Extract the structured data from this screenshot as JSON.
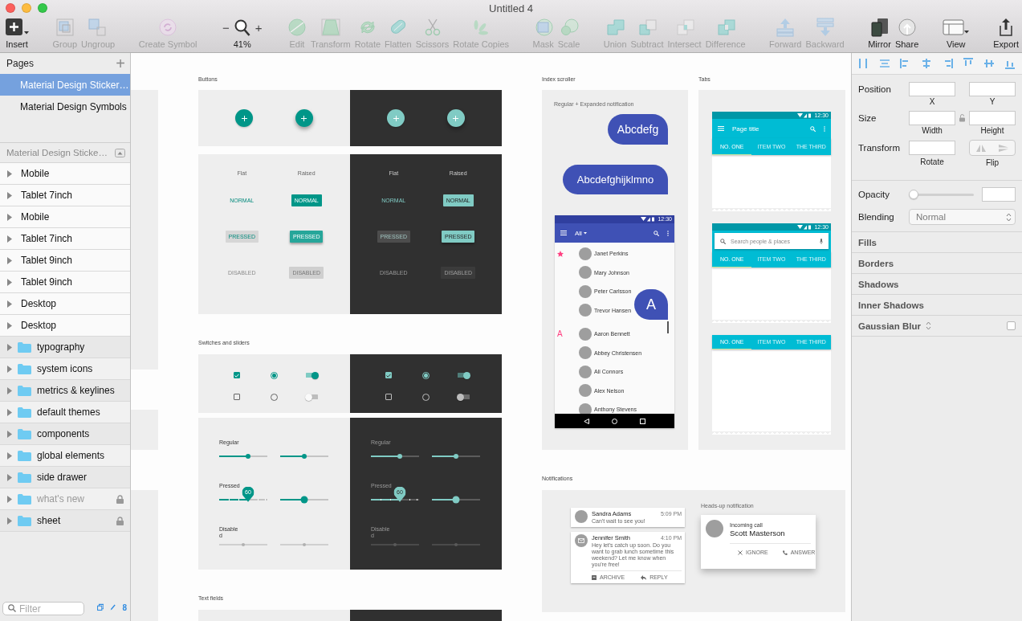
{
  "window": {
    "title": "Untitled 4"
  },
  "toolbar": {
    "groups": [
      {
        "items": [
          {
            "kind": "insert",
            "label": "Insert",
            "disabled": false
          }
        ]
      },
      {
        "items": [
          {
            "kind": "group",
            "label": "Group",
            "disabled": true
          },
          {
            "kind": "ungroup",
            "label": "Ungroup",
            "disabled": true
          }
        ]
      },
      {
        "items": [
          {
            "kind": "symbol",
            "label": "Create Symbol",
            "disabled": true
          }
        ]
      },
      {
        "items": [
          {
            "kind": "zoom",
            "label": "41%",
            "minus": "−",
            "plus": "+"
          }
        ]
      },
      {
        "items": [
          {
            "kind": "edit",
            "label": "Edit",
            "disabled": true
          },
          {
            "kind": "transform",
            "label": "Transform",
            "disabled": true
          },
          {
            "kind": "rotate",
            "label": "Rotate",
            "disabled": true
          },
          {
            "kind": "flatten",
            "label": "Flatten",
            "disabled": true
          },
          {
            "kind": "scissors",
            "label": "Scissors",
            "disabled": true
          },
          {
            "kind": "rotate_copies",
            "label": "Rotate Copies",
            "disabled": true
          }
        ]
      },
      {
        "items": [
          {
            "kind": "mask",
            "label": "Mask",
            "disabled": true
          },
          {
            "kind": "scale",
            "label": "Scale",
            "disabled": true
          }
        ]
      },
      {
        "items": [
          {
            "kind": "union",
            "label": "Union",
            "disabled": true
          },
          {
            "kind": "subtract",
            "label": "Subtract",
            "disabled": true
          },
          {
            "kind": "intersect",
            "label": "Intersect",
            "disabled": true
          },
          {
            "kind": "difference",
            "label": "Difference",
            "disabled": true
          }
        ]
      },
      {
        "items": [
          {
            "kind": "forward",
            "label": "Forward",
            "disabled": true
          },
          {
            "kind": "backward",
            "label": "Backward",
            "disabled": true
          }
        ]
      },
      {
        "items": [
          {
            "kind": "mirror",
            "label": "Mirror",
            "disabled": false
          },
          {
            "kind": "share",
            "label": "Share",
            "disabled": false
          }
        ]
      },
      {
        "items": [
          {
            "kind": "view",
            "label": "View",
            "disabled": false
          }
        ]
      },
      {
        "items": [
          {
            "kind": "export",
            "label": "Export",
            "disabled": false
          }
        ]
      }
    ]
  },
  "pages": {
    "title": "Pages",
    "add": "+",
    "items": [
      {
        "label": "Material Design Sticker…",
        "selected": true
      },
      {
        "label": "Material Design Symbols",
        "selected": false
      }
    ]
  },
  "layers": {
    "title": "Material Design Sticke…",
    "items": [
      {
        "kind": "artboard",
        "label": "Mobile",
        "locked": false,
        "hidden": false
      },
      {
        "kind": "artboard",
        "label": "Tablet 7inch",
        "locked": false,
        "hidden": false
      },
      {
        "kind": "artboard",
        "label": "Mobile",
        "locked": false,
        "hidden": false
      },
      {
        "kind": "artboard",
        "label": "Tablet 7inch",
        "locked": false,
        "hidden": false
      },
      {
        "kind": "artboard",
        "label": "Tablet 9inch",
        "locked": false,
        "hidden": false
      },
      {
        "kind": "artboard",
        "label": "Tablet 9inch",
        "locked": false,
        "hidden": false
      },
      {
        "kind": "artboard",
        "label": "Desktop",
        "locked": false,
        "hidden": false
      },
      {
        "kind": "artboard",
        "label": "Desktop",
        "locked": false,
        "hidden": false
      },
      {
        "kind": "folder",
        "label": "typography",
        "locked": false,
        "hidden": false
      },
      {
        "kind": "folder",
        "label": "system icons",
        "locked": false,
        "hidden": false
      },
      {
        "kind": "folder",
        "label": "metrics & keylines",
        "locked": false,
        "hidden": false
      },
      {
        "kind": "folder",
        "label": "default themes",
        "locked": false,
        "hidden": false
      },
      {
        "kind": "folder",
        "label": "components",
        "locked": false,
        "hidden": false
      },
      {
        "kind": "folder",
        "label": "global elements",
        "locked": false,
        "hidden": false
      },
      {
        "kind": "folder",
        "label": "side drawer",
        "locked": false,
        "hidden": false
      },
      {
        "kind": "folder",
        "label": "what's new",
        "locked": true,
        "hidden": true
      },
      {
        "kind": "folder",
        "label": "sheet",
        "locked": true,
        "hidden": false
      }
    ]
  },
  "filter": {
    "placeholder": "Filter",
    "count": "8"
  },
  "canvas": {
    "buttons": {
      "title": "Buttons",
      "fab_panels": [
        {
          "kind": "light"
        },
        {
          "kind": "dark"
        }
      ],
      "panels": [
        {
          "kind": "light",
          "headers": [
            "Flat",
            "Raised"
          ],
          "rows": [
            {
              "kind": "normal",
              "labels": [
                "NORMAL",
                "NORMAL"
              ]
            },
            {
              "kind": "pressed",
              "labels": [
                "PRESSED",
                "PRESSED"
              ]
            },
            {
              "kind": "disabled",
              "labels": [
                "DISABLED",
                "DISABLED"
              ]
            }
          ]
        },
        {
          "kind": "dark",
          "headers": [
            "Flat",
            "Raised"
          ],
          "rows": [
            {
              "kind": "normal",
              "labels": [
                "NORMAL",
                "NORMAL"
              ]
            },
            {
              "kind": "pressed",
              "labels": [
                "PRESSED",
                "PRESSED"
              ]
            },
            {
              "kind": "disabled",
              "labels": [
                "DISABLED",
                "DISABLED"
              ]
            }
          ]
        }
      ]
    },
    "switches": {
      "title": "Switches and sliders",
      "panels": [
        {
          "kind": "light",
          "rows": [
            {
              "checked": true
            },
            {
              "checked": false
            }
          ]
        },
        {
          "kind": "dark",
          "rows": [
            {
              "checked": true
            },
            {
              "checked": false
            }
          ]
        }
      ]
    },
    "sliders": {
      "panels": [
        {
          "kind": "light",
          "rows": [
            {
              "kind": "regular",
              "label": "Regular",
              "sliders": [
                {
                  "level": 0.6
                },
                {
                  "level": 0.5
                }
              ]
            },
            {
              "kind": "pressed",
              "label": "Pressed",
              "pin": "60",
              "sliders": [
                {
                  "level": 0.6
                },
                {
                  "level": 0.5
                }
              ]
            },
            {
              "kind": "disabled",
              "label": "Disabled",
              "sliders": [
                {
                  "level": 0.5
                },
                {
                  "level": 0.5
                }
              ]
            }
          ]
        },
        {
          "kind": "dark",
          "rows": [
            {
              "kind": "regular",
              "label": "Regular",
              "sliders": [
                {
                  "level": 0.6
                },
                {
                  "level": 0.5
                }
              ]
            },
            {
              "kind": "pressed",
              "label": "Pressed",
              "pin": "60",
              "sliders": [
                {
                  "level": 0.6
                },
                {
                  "level": 0.5
                }
              ]
            },
            {
              "kind": "disabled",
              "label": "Disabled",
              "sliders": [
                {
                  "level": 0.5
                },
                {
                  "level": 0.5
                }
              ]
            }
          ]
        }
      ]
    },
    "text_fields": {
      "title": "Text fields",
      "panels": [
        {
          "kind": "light"
        },
        {
          "kind": "dark"
        }
      ]
    },
    "index_scroller": {
      "title": "Index scroller",
      "caption": "Regular + Expanded notification",
      "bubbles": [
        "Abcdefg",
        "Abcdefghijklmno"
      ],
      "phone": {
        "time": "12:30",
        "filter": "All",
        "index_letter": "A",
        "contacts": [
          {
            "kind": "starred",
            "name": "Janet Perkins"
          },
          {
            "kind": "plain",
            "name": "Mary Johnson"
          },
          {
            "kind": "plain",
            "name": "Peter Carlsson"
          },
          {
            "kind": "plain",
            "name": "Trevor Hansen"
          },
          {
            "kind": "letter",
            "letter": "A",
            "name": "Aaron Bennett"
          },
          {
            "kind": "plain",
            "name": "Abbey Christensen"
          },
          {
            "kind": "plain",
            "name": "Ali Connors"
          },
          {
            "kind": "plain",
            "name": "Alex Nelson"
          },
          {
            "kind": "plain",
            "name": "Anthony Stevens"
          }
        ]
      }
    },
    "tabs": {
      "title": "Tabs",
      "phones": [
        {
          "kind": "titled",
          "time": "12:30",
          "title": "Page title",
          "tabs": [
            {
              "label": "NO. ONE",
              "selected": true
            },
            {
              "label": "ITEM TWO",
              "selected": false
            },
            {
              "label": "THE THIRD",
              "selected": false
            }
          ]
        },
        {
          "kind": "search",
          "time": "12:30",
          "placeholder": "Search people & places",
          "tabs": [
            {
              "label": "NO. ONE",
              "selected": true
            },
            {
              "label": "ITEM TWO",
              "selected": false
            },
            {
              "label": "THE THIRD",
              "selected": false
            }
          ]
        },
        {
          "kind": "plain",
          "tabs": [
            {
              "label": "NO. ONE",
              "selected": true
            },
            {
              "label": "ITEM TWO",
              "selected": false
            },
            {
              "label": "THE THIRD",
              "selected": false
            }
          ]
        }
      ]
    },
    "notifications": {
      "title": "Notifications",
      "caption": "Heads-up notification",
      "cards": [
        {
          "kind": "short",
          "name": "Sandra Adams",
          "time": "5:09 PM",
          "text": "Can't wait to see you!"
        },
        {
          "kind": "expanded",
          "name": "Jennifer Smith",
          "time": "4:10 PM",
          "text": "Hey let's catch up soon. Do you want to grab lunch sometime this weekend? Let me know when you're free!",
          "actions": [
            "ARCHIVE",
            "REPLY"
          ]
        }
      ],
      "heads_up": {
        "subtitle": "Incoming call",
        "name": "Scott Masterson",
        "actions": [
          "IGNORE",
          "ANSWER"
        ]
      }
    }
  },
  "inspector": {
    "rows": [
      {
        "kind": "pair",
        "label": "Position",
        "fields": [
          "X",
          "Y"
        ]
      },
      {
        "kind": "pair",
        "label": "Size",
        "locked": false,
        "fields": [
          "Width",
          "Height"
        ]
      },
      {
        "kind": "flip",
        "label": "Transform",
        "fields": [
          "Rotate"
        ],
        "flip": "Flip"
      }
    ],
    "opacity": {
      "label": "Opacity",
      "level": 0
    },
    "blending": {
      "label": "Blending",
      "value": "Normal"
    },
    "sections": [
      {
        "kind": "plain",
        "label": "Fills"
      },
      {
        "kind": "plain",
        "label": "Borders"
      },
      {
        "kind": "plain",
        "label": "Shadows"
      },
      {
        "kind": "plain",
        "label": "Inner Shadows"
      },
      {
        "kind": "toggle",
        "label": "Gaussian Blur",
        "checked": false
      }
    ]
  }
}
